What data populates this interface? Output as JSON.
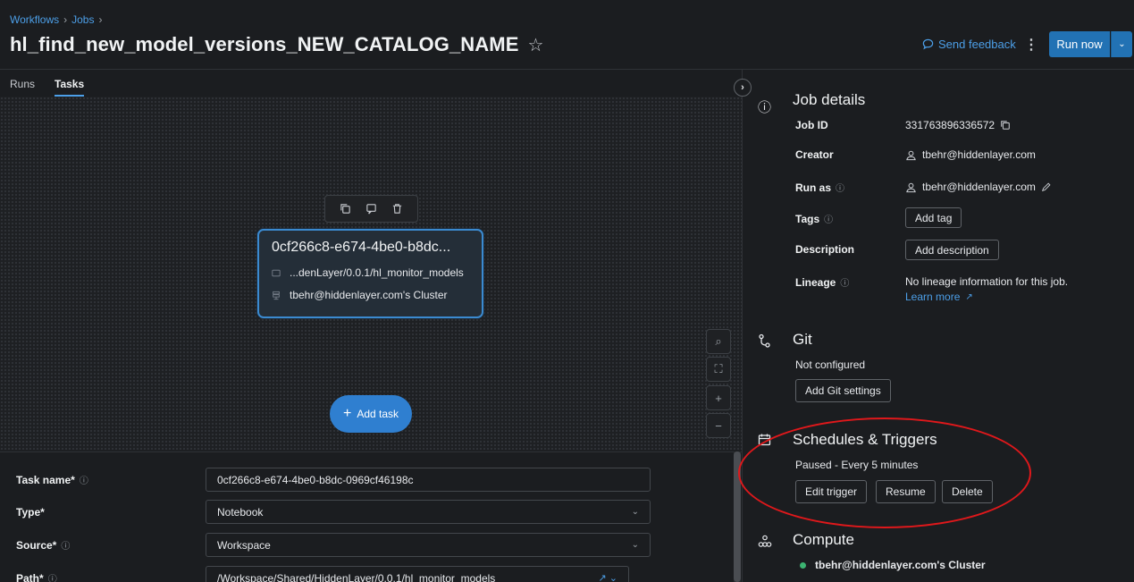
{
  "breadcrumb": {
    "workflows": "Workflows",
    "jobs": "Jobs",
    "sep": "›"
  },
  "page": {
    "title": "hl_find_new_model_versions_NEW_CATALOG_NAME",
    "star": "☆"
  },
  "header": {
    "feedback": "Send feedback",
    "run_now": "Run now",
    "kebab": "⋮",
    "run_menu": "⌄"
  },
  "tabs": [
    {
      "label": "Runs"
    },
    {
      "label": "Tasks"
    }
  ],
  "node": {
    "title": "0cf266c8-e674-4be0-b8dc...",
    "path": "...denLayer/0.0.1/hl_monitor_models",
    "cluster": "tbehr@hiddenlayer.com's Cluster"
  },
  "canvas": {
    "add_task": "Add task",
    "add_plus": "+"
  },
  "zoom": {
    "search": "⌕",
    "fit": "⛶",
    "zoom_in": "+",
    "zoom_out": "−"
  },
  "form": {
    "task_name_label": "Task name*",
    "task_name_value": "0cf266c8-e674-4be0-b8dc-0969cf46198c",
    "type_label": "Type*",
    "type_value": "Notebook",
    "source_label": "Source*",
    "source_value": "Workspace",
    "path_label": "Path*",
    "path_value": "/Workspace/Shared/HiddenLayer/0.0.1/hl_monitor_models"
  },
  "job_details": {
    "title": "Job details",
    "job_id_label": "Job ID",
    "job_id_value": "331763896336572",
    "creator_label": "Creator",
    "creator_value": "tbehr@hiddenlayer.com",
    "run_as_label": "Run as",
    "run_as_value": "tbehr@hiddenlayer.com",
    "tags_label": "Tags",
    "add_tag": "Add tag",
    "description_label": "Description",
    "add_description": "Add description",
    "lineage_label": "Lineage",
    "lineage_value": "No lineage information for this job.",
    "learn_more": "Learn more"
  },
  "git": {
    "title": "Git",
    "status": "Not configured",
    "add_settings": "Add Git settings"
  },
  "schedules": {
    "title": "Schedules & Triggers",
    "status": "Paused - Every 5 minutes",
    "edit_trigger": "Edit trigger",
    "resume": "Resume",
    "delete": "Delete"
  },
  "compute": {
    "title": "Compute",
    "cluster": "tbehr@hiddenlayer.com's Cluster"
  },
  "colors": {
    "accent": "#2272b4",
    "link": "#4c9fe8",
    "annotation": "#e0181b",
    "status_green": "#3cb371"
  }
}
